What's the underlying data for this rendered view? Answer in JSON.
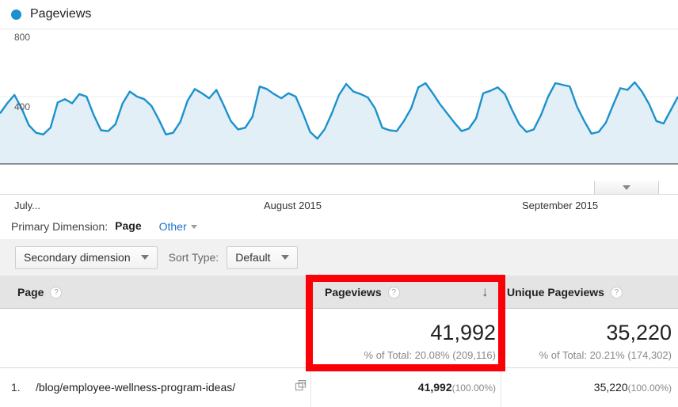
{
  "legend": {
    "label": "Pageviews",
    "dot_color": "#1c91cd"
  },
  "chart": {
    "yticks": [
      "800",
      "400"
    ],
    "xticks": [
      "July...",
      "August 2015",
      "September 2015"
    ],
    "scroll_caret_icon": "chevron-down-icon",
    "line_color": "#1c91cd",
    "fill_color": "#e2eff7"
  },
  "primary_dimension": {
    "label": "Primary Dimension:",
    "active": "Page",
    "other": "Other",
    "other_caret_icon": "chevron-down-icon"
  },
  "controls": {
    "secondary_dimension": "Secondary dimension",
    "secondary_caret_icon": "chevron-down-icon",
    "sort_type_label": "Sort Type:",
    "sort_type_value": "Default",
    "sort_caret_icon": "chevron-down-icon"
  },
  "table": {
    "headers": {
      "page": "Page",
      "pageviews": "Pageviews",
      "unique_pageviews": "Unique Pageviews",
      "help_icon": "?",
      "sort_arrow_icon": "↓"
    },
    "summary": {
      "pageviews_value": "41,992",
      "pageviews_subtext": "% of Total: 20.08% (209,116)",
      "unique_value": "35,220",
      "unique_subtext": "% of Total: 20.21% (174,302)"
    },
    "rows": [
      {
        "index": "1.",
        "page": "/blog/employee-wellness-program-ideas/",
        "popout_icon": "open-in-new-icon",
        "pageviews": "41,992",
        "pageviews_pct": "(100.00%)",
        "unique": "35,220",
        "unique_pct": "(100.00%)"
      }
    ]
  },
  "annotation": {
    "box_color": "#fb0007"
  },
  "chart_data": {
    "type": "area",
    "title": "Pageviews",
    "xlabel": "",
    "ylabel": "Pageviews",
    "ylim": [
      0,
      800
    ],
    "yticks": [
      400,
      800
    ],
    "grid": true,
    "legend": [
      "Pageviews"
    ],
    "xtick_labels": [
      "July...",
      "August 2015",
      "September 2015"
    ],
    "series": [
      {
        "name": "Pageviews",
        "values": [
          300,
          360,
          410,
          330,
          230,
          185,
          175,
          215,
          365,
          385,
          360,
          415,
          400,
          290,
          200,
          195,
          235,
          360,
          430,
          400,
          385,
          345,
          265,
          175,
          185,
          250,
          375,
          445,
          420,
          390,
          440,
          350,
          255,
          205,
          215,
          280,
          460,
          445,
          415,
          390,
          420,
          400,
          300,
          190,
          150,
          205,
          300,
          410,
          475,
          430,
          415,
          395,
          330,
          215,
          200,
          195,
          255,
          330,
          455,
          480,
          420,
          355,
          300,
          245,
          195,
          210,
          270,
          420,
          435,
          455,
          415,
          320,
          235,
          190,
          205,
          290,
          400,
          480,
          470,
          460,
          340,
          255,
          180,
          190,
          245,
          350,
          450,
          440,
          485,
          430,
          355,
          255,
          240,
          320,
          400
        ]
      }
    ]
  }
}
